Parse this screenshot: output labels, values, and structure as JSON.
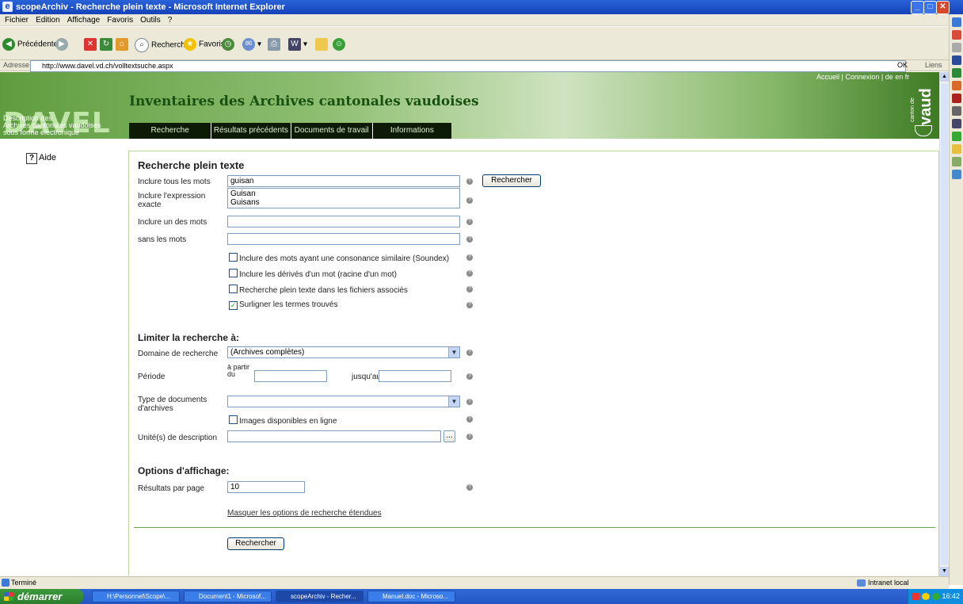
{
  "window": {
    "title": "scopeArchiv - Recherche plein texte - Microsoft Internet Explorer"
  },
  "menu": [
    "Fichier",
    "Edition",
    "Affichage",
    "Favoris",
    "Outils",
    "?"
  ],
  "toolbar": {
    "back": "Précédente",
    "search": "Rechercher",
    "favorites": "Favoris"
  },
  "address": {
    "label": "Adresse",
    "url": "http://www.davel.vd.ch/volltextsuche.aspx",
    "go": "OK",
    "links": "Liens"
  },
  "header": {
    "logo": "DAVEL",
    "logo_sub": [
      "Description des",
      "Archives cantonales vaudoises",
      "sous forme électronique"
    ],
    "title": "Inventaires des Archives cantonales vaudoises",
    "toplinks": "Accueil  |  Connexion  |  de  en  fr",
    "vaud_small": "canton de",
    "vaud": "vaud",
    "nav": [
      "Recherche",
      "Résultats précédents",
      "Documents de travail",
      "Informations"
    ]
  },
  "aide": "Aide",
  "form": {
    "heading": "Recherche plein texte",
    "all_words_label": "Inclure tous les mots",
    "all_words_value": "guisan",
    "search_button": "Rechercher",
    "exact_label": "Inclure l'expression exacte",
    "suggestions": [
      "Guisan",
      "Guisans"
    ],
    "one_of_label": "Inclure un des mots",
    "without_label": "sans les mots",
    "opt_soundex": "Inclure des mots ayant une consonance similaire (Soundex)",
    "opt_derived": "Inclure les dérivés d'un mot (racine d'un mot)",
    "opt_files": "Recherche plein texte dans les fichiers associés",
    "opt_highlight": "Surligner les termes trouvés",
    "limit_heading": "Limiter la recherche à:",
    "domain_label": "Domaine de recherche",
    "domain_value": "(Archives complètes)",
    "period_label": "Période",
    "from_label": "à partir du",
    "to_label": "jusqu'au",
    "doctype_label": "Type de documents d'archives",
    "opt_images": "Images disponibles en ligne",
    "units_label": "Unité(s) de description",
    "browse": "...",
    "display_heading": "Options d'affichage:",
    "per_page_label": "Résultats par page",
    "per_page_value": "10",
    "hide_link": "Masquer les options de recherche étendues",
    "bottom_button": "Rechercher"
  },
  "status": {
    "text": "Terminé",
    "zone": "Intranet local"
  },
  "taskbar": {
    "start": "démarrer",
    "tasks": [
      "H:\\Personnel\\Scope\\...",
      "Document1 - Microsof...",
      "scopeArchiv - Recher...",
      "Manuel.doc - Microso..."
    ],
    "clock": "16:42"
  },
  "colors": {
    "header_green": "#5f9c3f",
    "nav_dark": "#0c1a06",
    "title_green": "#17500f",
    "xp_blue": "#2457c5"
  }
}
